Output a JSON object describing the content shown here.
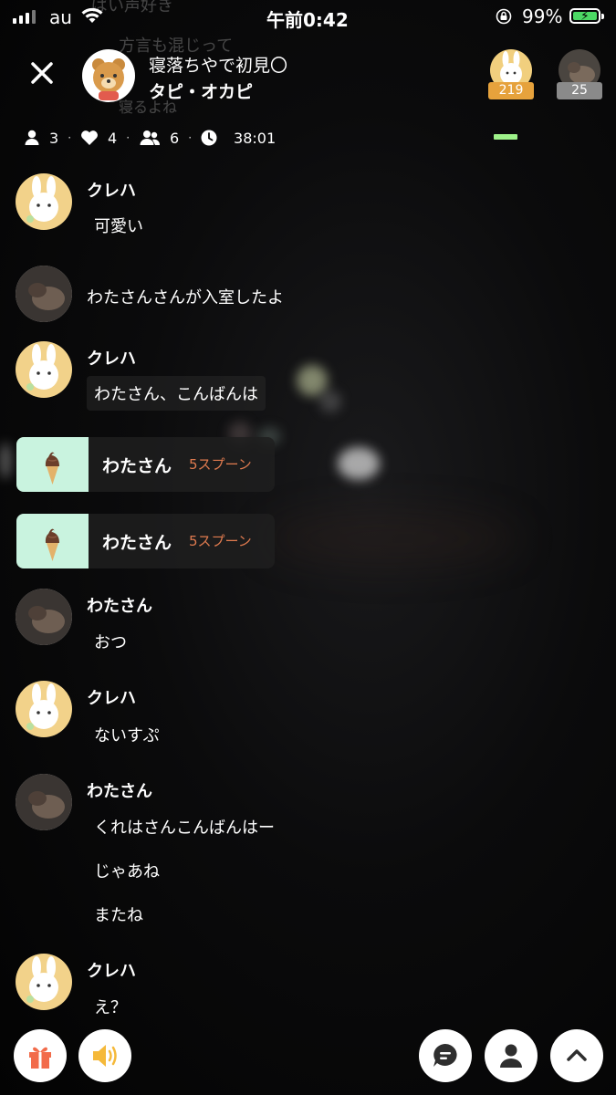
{
  "status_bar": {
    "carrier": "au",
    "time": "午前0:42",
    "battery_percent": "99%"
  },
  "background_text": {
    "line1": "ぱい声好き",
    "line2": "方言も混じって",
    "line3": "寝るよね"
  },
  "header": {
    "room_title": "寝落ちやで初見〇",
    "host_name": "タピ・オカピ",
    "rankers": [
      {
        "score": "219"
      },
      {
        "score": "25"
      }
    ]
  },
  "stats": {
    "listeners": "3",
    "likes": "4",
    "members": "6",
    "duration": "38:01"
  },
  "chat": {
    "m1_user": "クレハ",
    "m1_text": "可愛い",
    "m2_system": "わたさんさんが入室したよ",
    "m3_user": "クレハ",
    "m3_text": "わたさん、こんばんは",
    "g1_user": "わたさん",
    "g1_amount": "5スプーン",
    "g2_user": "わたさん",
    "g2_amount": "5スプーン",
    "m4_user": "わたさん",
    "m4_text": "おつ",
    "m5_user": "クレハ",
    "m5_text": "ないすぷ",
    "m6_user": "わたさん",
    "m6_text1": "くれはさんこんばんはー",
    "m6_text2": "じゃあね",
    "m6_text3": "またね",
    "m7_user": "クレハ",
    "m7_text": "え？"
  },
  "colors": {
    "accent_green": "#9ef28a",
    "gift_bg": "#c9f3df",
    "spoon_text": "#e07b4f",
    "rank1": "#e6a23c",
    "rank2": "#8a8a8a"
  }
}
